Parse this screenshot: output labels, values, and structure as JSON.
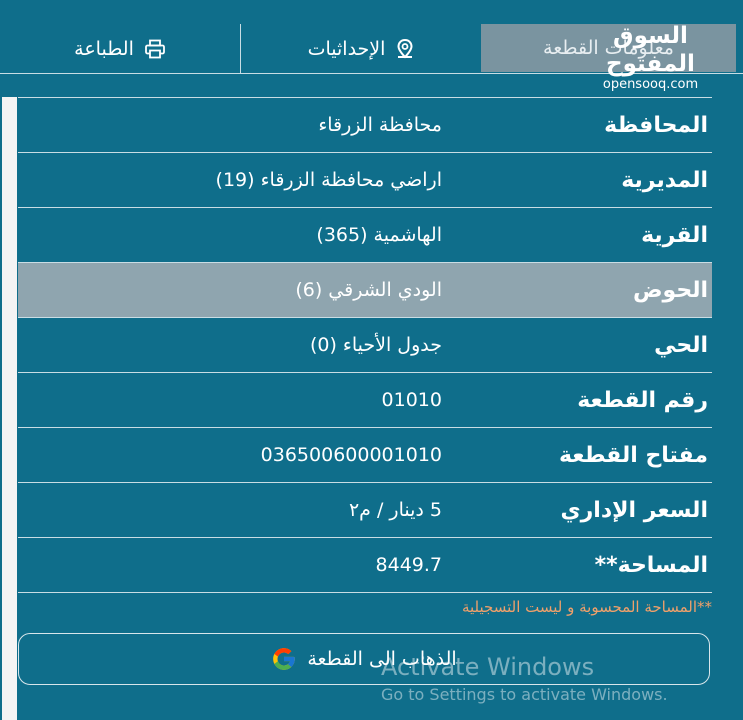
{
  "tabs": {
    "parcel_info": "معلومات القطعة",
    "coordinates": "الإحداثيات",
    "print": "الطباعة"
  },
  "watermark": {
    "arabic": "السوق المفتوح",
    "english": "opensooq.com"
  },
  "rows": [
    {
      "label": "المحافظة",
      "value": "محافظة الزرقاء"
    },
    {
      "label": "المديرية",
      "value": "اراضي محافظة الزرقاء (19)"
    },
    {
      "label": "القرية",
      "value": "الهاشمية (365)"
    },
    {
      "label": "الحوض",
      "value": "الودي الشرقي (6)"
    },
    {
      "label": "الحي",
      "value": "جدول الأحياء (0)"
    },
    {
      "label": "رقم القطعة",
      "value": "01010"
    },
    {
      "label": "مفتاح القطعة",
      "value": "036500600001010"
    },
    {
      "label": "السعر الإداري",
      "value": "5 دينار / م٢"
    },
    {
      "label": "المساحة**",
      "value": "8449.7"
    }
  ],
  "note": "**المساحة المحسوبة و ليست التسجيلية",
  "go_button": "الذهاب الى القطعة",
  "windows_watermark": {
    "line1": "Activate Windows",
    "line2": "Go to Settings to activate Windows."
  },
  "colors": {
    "background": "#0f6e8b",
    "active_tab": "#7a94a0",
    "highlight_row": "#8fa5af",
    "note": "#f0a06a"
  },
  "icons": [
    "map-pin-icon",
    "printer-icon",
    "google-icon"
  ]
}
